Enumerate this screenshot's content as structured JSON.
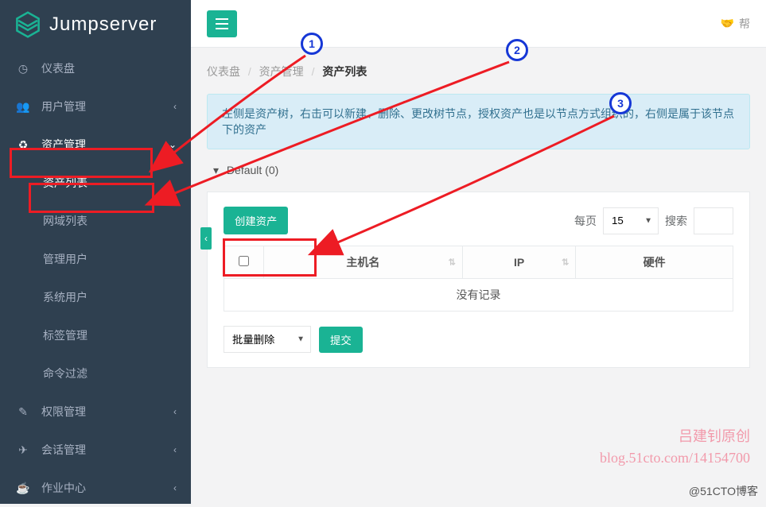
{
  "brand": "Jumpserver",
  "topbar": {
    "help": "帮"
  },
  "sidebar": {
    "items": [
      {
        "label": "仪表盘"
      },
      {
        "label": "用户管理"
      },
      {
        "label": "资产管理"
      },
      {
        "label": "资产列表"
      },
      {
        "label": "网域列表"
      },
      {
        "label": "管理用户"
      },
      {
        "label": "系统用户"
      },
      {
        "label": "标签管理"
      },
      {
        "label": "命令过滤"
      },
      {
        "label": "权限管理"
      },
      {
        "label": "会话管理"
      },
      {
        "label": "作业中心"
      }
    ]
  },
  "breadcrumb": {
    "a": "仪表盘",
    "b": "资产管理",
    "c": "资产列表"
  },
  "info_text": "左侧是资产树，右击可以新建、删除、更改树节点，授权资产也是以节点方式组织的，右侧是属于该节点下的资产",
  "tree_root": "Default (0)",
  "panel": {
    "create_btn": "创建资产",
    "perpage_label": "每页",
    "perpage_value": "15",
    "search_label": "搜索",
    "cols": {
      "host": "主机名",
      "ip": "IP",
      "hw": "硬件"
    },
    "empty": "没有记录",
    "bulk_value": "批量删除",
    "submit": "提交"
  },
  "watermark": {
    "line1": "吕建钊原创",
    "line2": "blog.51cto.com/14154700",
    "attr": "@51CTO博客"
  }
}
